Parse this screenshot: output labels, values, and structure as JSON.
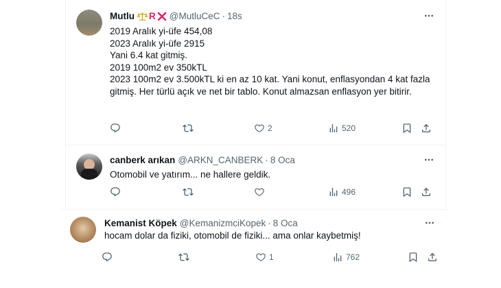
{
  "tweets": [
    {
      "name": "Mutlu",
      "badges": [
        "scale-icon",
        "R",
        "red-x-icon"
      ],
      "badge_R": "R",
      "handle": "@MutluCeC",
      "time": "18s",
      "lines": [
        "2019 Aralık yi-üfe 454,08",
        "2023 Aralık yi-üfe 2915",
        "Yani 6.4 kat gitmiş.",
        "2019 100m2 ev 350kTL",
        "2023 100m2 ev 3.500kTL ki en az 10 kat. Yani konut, enflasyondan 4 kat fazla gitmiş. Her türlü açık ve net bir tablo. Konut almazsan enflasyon yer bitirir."
      ],
      "replies": "",
      "retweets": "",
      "likes": "2",
      "views": "520"
    },
    {
      "name": "canberk arıkan",
      "handle": "@ARKN_CANBERK",
      "time": "8 Oca",
      "lines": [
        "Otomobil ve yatırım... ne hallere geldik."
      ],
      "replies": "",
      "retweets": "",
      "likes": "",
      "views": "496"
    },
    {
      "name": "Kemanist Köpek",
      "handle": "@KemanizmciKopek",
      "time": "8 Oca",
      "lines": [
        "hocam dolar da fiziki, otomobil de fiziki... ama onlar kaybetmiş!"
      ],
      "replies": "",
      "retweets": "",
      "likes": "1",
      "views": "762"
    }
  ],
  "colors": {
    "text": "#0f1419",
    "secondary": "#536471",
    "border": "#eff3f4",
    "badge_red": "#e0245e",
    "badge_gold": "#d4a017"
  },
  "icons": [
    "reply-icon",
    "retweet-icon",
    "like-icon",
    "views-icon",
    "bookmark-icon",
    "share-icon",
    "more-icon"
  ]
}
